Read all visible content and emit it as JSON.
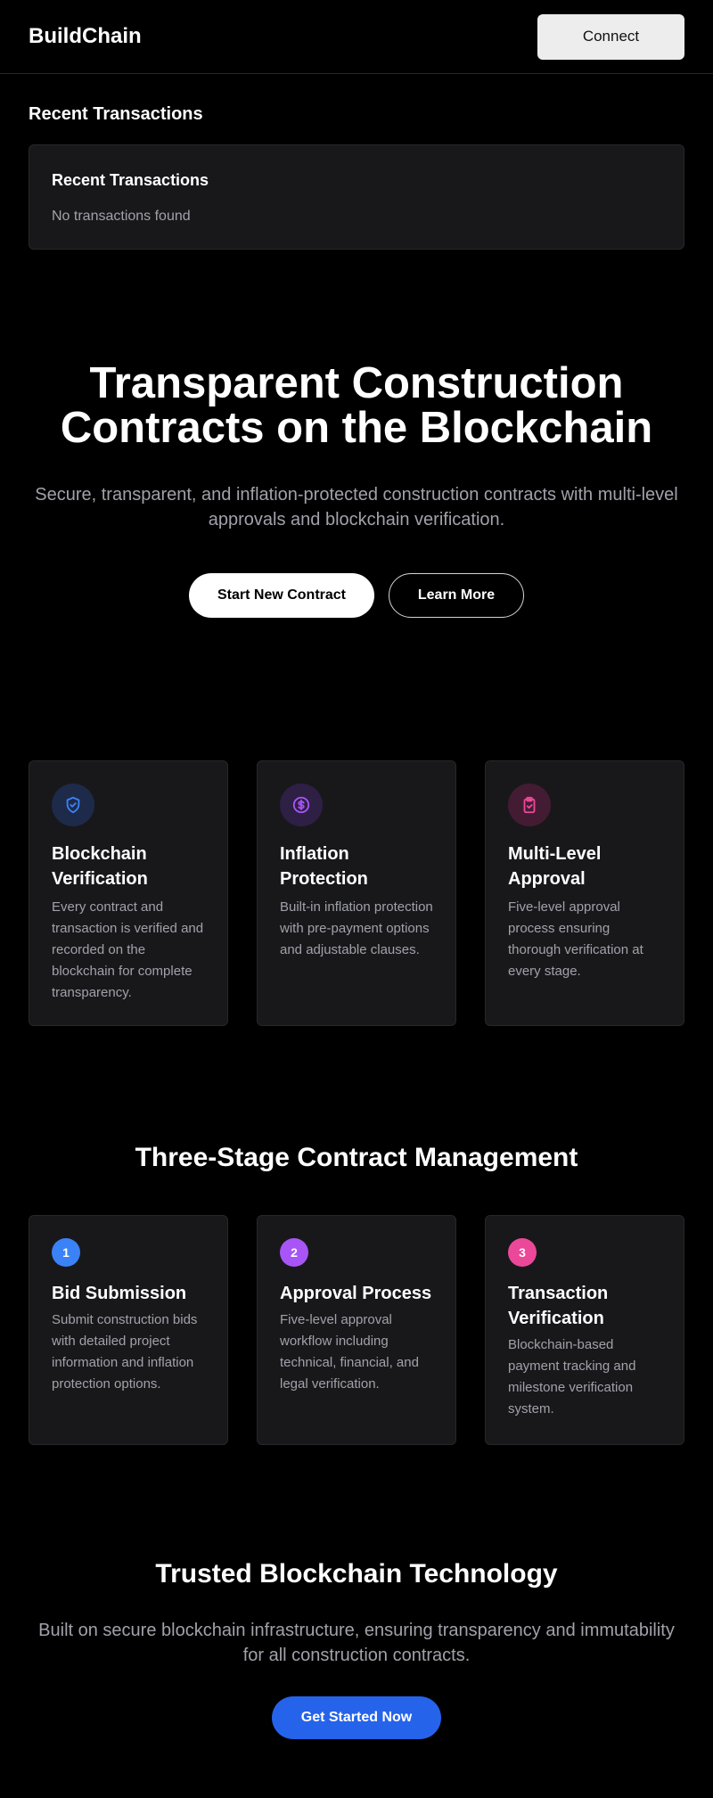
{
  "header": {
    "logo": "BuildChain",
    "connect_label": "Connect"
  },
  "recent": {
    "heading": "Recent Transactions",
    "card_title": "Recent Transactions",
    "empty_text": "No transactions found"
  },
  "hero": {
    "title_line1": "Transparent Construction",
    "title_line2": "Contracts on the Blockchain",
    "subtitle": "Secure, transparent, and inflation-protected construction contracts with multi-level approvals and blockchain verification.",
    "primary_label": "Start New Contract",
    "secondary_label": "Learn More"
  },
  "features": [
    {
      "icon": "shield-check-icon",
      "color": "#3b82f6",
      "bg": "#1e2a4a",
      "title": "Blockchain Verification",
      "desc": "Every contract and transaction is verified and recorded on the blockchain for complete transparency."
    },
    {
      "icon": "dollar-circle-icon",
      "color": "#a855f7",
      "bg": "#2e1f45",
      "title": "Inflation Protection",
      "desc": "Built-in inflation protection with pre-payment options and adjustable clauses."
    },
    {
      "icon": "clipboard-check-icon",
      "color": "#ec4899",
      "bg": "#431c33",
      "title": "Multi-Level Approval",
      "desc": "Five-level approval process ensuring thorough verification at every stage."
    }
  ],
  "stages": {
    "title": "Three-Stage Contract Management",
    "items": [
      {
        "num": "1",
        "color": "#3b82f6",
        "title": "Bid Submission",
        "desc": "Submit construction bids with detailed project information and inflation protection options."
      },
      {
        "num": "2",
        "color": "#a855f7",
        "title": "Approval Process",
        "desc": "Five-level approval workflow including technical, financial, and legal verification."
      },
      {
        "num": "3",
        "color": "#ec4899",
        "title": "Transaction Verification",
        "desc": "Blockchain-based payment tracking and milestone verification system."
      }
    ]
  },
  "trust": {
    "title": "Trusted Blockchain Technology",
    "subtitle": "Built on secure blockchain infrastructure, ensuring transparency and immutability for all construction contracts.",
    "cta_label": "Get Started Now"
  }
}
